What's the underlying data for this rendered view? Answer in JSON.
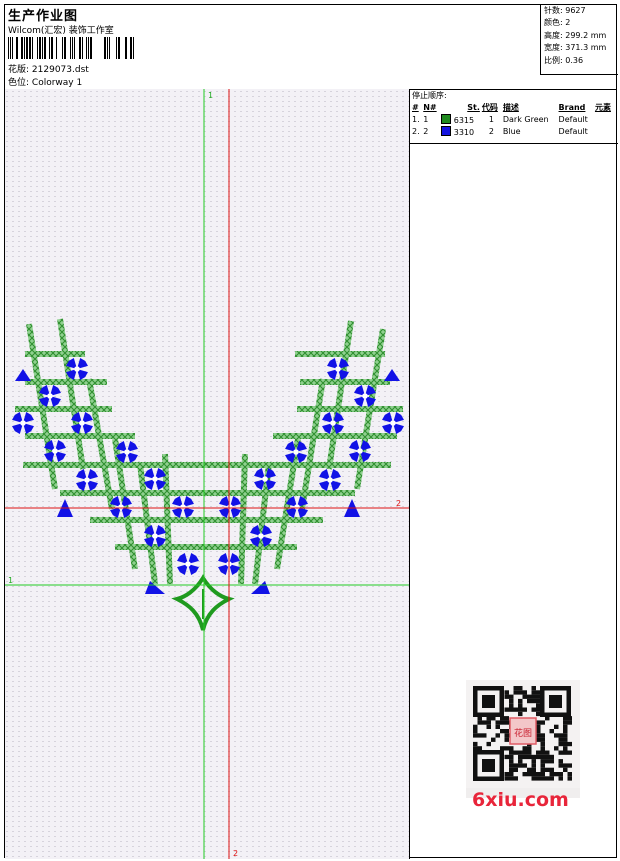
{
  "header": {
    "title": "生产作业图",
    "subtitle": "Wilcom(汇宏) 装饰工作室",
    "design_label": "花版:",
    "design_value": "2129073.dst",
    "colorway_label": "色位:",
    "colorway_value": "Colorway 1"
  },
  "stats": [
    {
      "label": "针数:",
      "value": "9627"
    },
    {
      "label": "颜色:",
      "value": "2"
    },
    {
      "label": "高度:",
      "value": "299.2 mm"
    },
    {
      "label": "宽度:",
      "value": "371.3 mm"
    },
    {
      "label": "比例:",
      "value": "0.36"
    }
  ],
  "stop_sequence": {
    "title": "停止顺序:",
    "columns": [
      "#",
      "N#",
      "St.",
      "代码",
      "描述",
      "Brand",
      "元素"
    ],
    "rows": [
      {
        "idx": "1.",
        "n": "1",
        "color": "#1f8a1f",
        "st": "6315",
        "code": "1",
        "desc": "Dark Green",
        "brand": "Default"
      },
      {
        "idx": "2.",
        "n": "2",
        "color": "#1414e0",
        "st": "3310",
        "code": "2",
        "desc": "Blue",
        "brand": "Default"
      }
    ]
  },
  "axes": {
    "green_v_label": "1",
    "green_h_label": "1",
    "red_h_label": "2",
    "red_v_label": "2"
  },
  "colors": {
    "green_axis": "#22cc22",
    "red_axis": "#dd1111",
    "thread_green": "#3aa23a",
    "thread_blue": "#1212e6"
  },
  "watermark": {
    "site": "6xiu.com",
    "seal": "花图"
  }
}
